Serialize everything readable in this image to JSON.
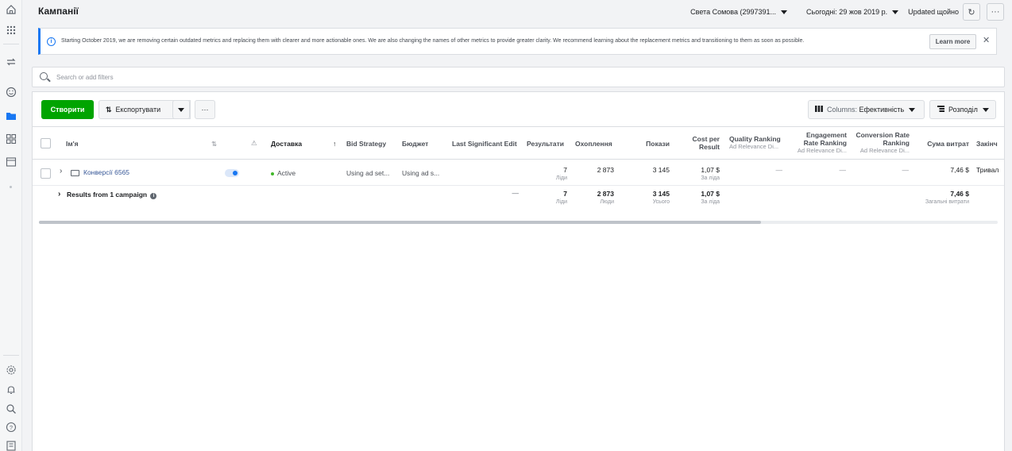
{
  "rail": {
    "icons": [
      "home-icon",
      "apps-grid-icon",
      "switch-icon",
      "smiley-icon",
      "folder-icon",
      "blocks-icon",
      "calendar-icon",
      "settings-icon",
      "bell-icon",
      "search-icon",
      "help-icon",
      "report-icon"
    ],
    "active": "folder-icon"
  },
  "header": {
    "title": "Кампанії",
    "account": "Света Сомова (2997391...",
    "date_range": "Сьогодні: 29 жов 2019 р.",
    "updated": "Updated щойно",
    "refresh_icon": "↻",
    "more_icon": "···"
  },
  "notice": {
    "icon": "i",
    "message": "Starting October 2019, we are removing certain outdated metrics and replacing them with clearer and more actionable ones. We are also changing the names of other metrics to provide greater clarity. We recommend learning about the replacement metrics and transitioning to them as soon as possible.",
    "learn_more": "Learn more",
    "close": "✕"
  },
  "search": {
    "placeholder": "Search or add filters"
  },
  "toolbar": {
    "create": "Створити",
    "export": "Експортувати",
    "export_icon": "⇅",
    "more": "···",
    "columns_prefix": "Columns: ",
    "columns_value": "Ефективність",
    "breakdown": "Розподіл"
  },
  "table": {
    "headers": {
      "name": "Ім'я",
      "sort_icon": "⇅",
      "warning_icon": "⚠",
      "delivery": "Доставка",
      "sort_arrow": "↑",
      "bid_strategy": "Bid Strategy",
      "budget": "Бюджет",
      "last_edit": "Last Significant Edit",
      "results": "Результати",
      "reach": "Охоплення",
      "impressions": "Покази",
      "cost_per_result_1": "Cost per",
      "cost_per_result_2": "Result",
      "quality_ranking": "Quality Ranking",
      "quality_sub": "Ad Relevance Di...",
      "engagement_1": "Engagement",
      "engagement_2": "Rate Ranking",
      "engagement_sub": "Ad Relevance Di...",
      "conversion_1": "Conversion Rate",
      "conversion_2": "Ranking",
      "conversion_sub": "Ad Relevance Di...",
      "amount_spent": "Сума витрат",
      "ends": "Закінч"
    },
    "row": {
      "name": "Конверсії 6565",
      "delivery": "Active",
      "bid_strategy": "Using ad set...",
      "budget": "Using ad s...",
      "results": "7",
      "results_sub": "Ліди",
      "reach": "2 873",
      "impressions": "3 145",
      "cost": "1,07 $",
      "cost_sub": "За ліда",
      "quality": "—",
      "engagement": "—",
      "conversion": "—",
      "spent": "7,46 $",
      "ends": "Тривал"
    },
    "summary": {
      "label": "Results from 1 campaign",
      "info_icon": "i",
      "last_edit": "—",
      "results": "7",
      "results_sub": "Ліди",
      "reach": "2 873",
      "reach_sub": "Люди",
      "impressions": "3 145",
      "impressions_sub": "Усього",
      "cost": "1,07 $",
      "cost_sub": "За ліда",
      "spent": "7,46 $",
      "spent_sub": "Загальні витрати"
    }
  },
  "colors": {
    "create_button": "#00a400",
    "accent": "#1877f2",
    "active_dot": "#42b72a"
  }
}
